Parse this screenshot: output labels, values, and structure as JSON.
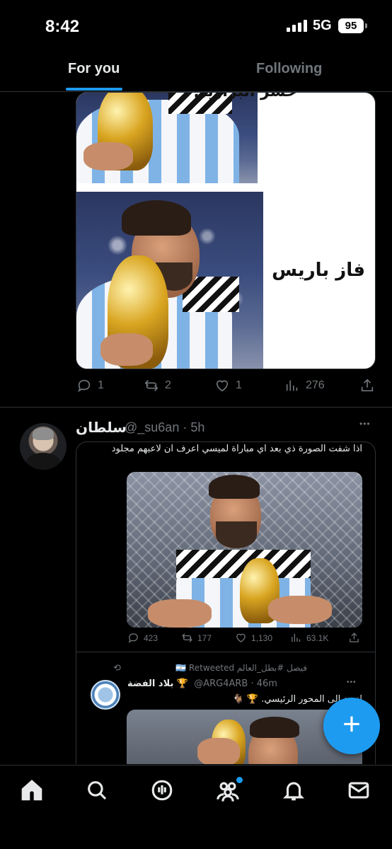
{
  "status_bar": {
    "time": "8:42",
    "network": "5G",
    "battery": "95"
  },
  "tabs": [
    {
      "label": "For you",
      "active": true
    },
    {
      "label": "Following",
      "active": false
    }
  ],
  "tweet1": {
    "image_caption": "فاز باريس",
    "image_caption_top": "خسر البرازيل",
    "actions": {
      "replies": "1",
      "retweets": "2",
      "likes": "1",
      "views": "276"
    }
  },
  "tweet2": {
    "author_name": "سلطان",
    "handle_time": "@_su6an · 5h",
    "more": "•••",
    "embed": {
      "text": "اذا شفت الصورة ذي بعد اي مباراة لميسي اعرف ان لاعبهم مجلود",
      "actions": {
        "replies": "423",
        "retweets": "177",
        "likes": "1,130",
        "views": "63.1K"
      },
      "retweeted_by": "فيصل #بطل_العالم 🇦🇷 Retweeted",
      "quoted": {
        "name": "بلاد الفضة 🏆",
        "handle_time": "@ARG4ARB · 46m",
        "text": "لنعود إلى المحور الرئيسي. 🏆 🐐",
        "more": "•••"
      }
    }
  },
  "fab": {
    "label": "+"
  },
  "bottom_nav": [
    "home-icon",
    "search-icon",
    "spaces-icon",
    "communities-icon",
    "notifications-icon",
    "messages-icon"
  ],
  "colors": {
    "accent": "#1d9bf0",
    "background": "#000000",
    "muted": "#71767b",
    "text": "#e7e9ea",
    "divider": "#2f3336"
  }
}
